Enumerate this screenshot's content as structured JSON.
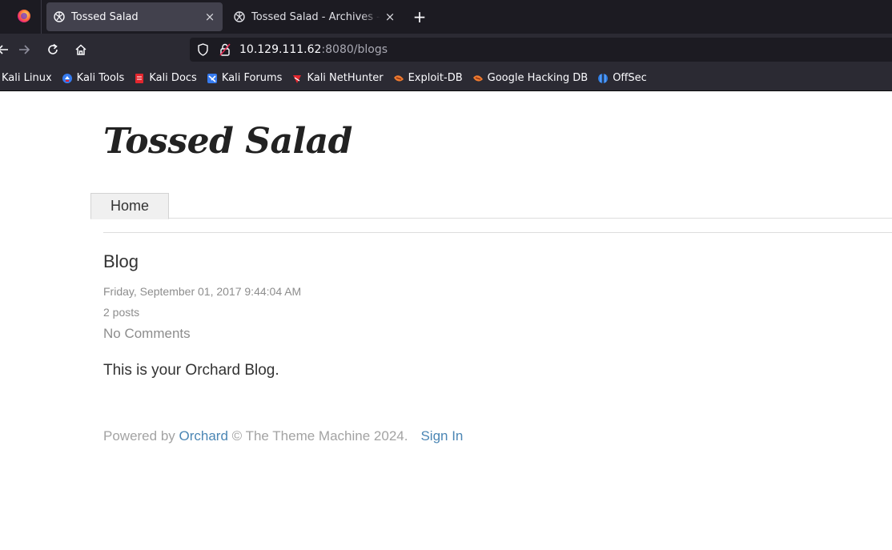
{
  "browser": {
    "tabs": [
      {
        "title": "Tossed Salad",
        "active": true
      },
      {
        "title": "Tossed Salad - Archives - ",
        "active": false
      }
    ],
    "close_glyph": "×",
    "new_tab_glyph": "+",
    "url": {
      "host": "10.129.111.62",
      "rest": ":8080/blogs"
    },
    "bookmarks": [
      {
        "label": "Kali Linux",
        "icon": "kali-icon",
        "color": "#367bf0"
      },
      {
        "label": "Kali Tools",
        "icon": "kali-tools-icon",
        "color": "#367bf0"
      },
      {
        "label": "Kali Docs",
        "icon": "kali-docs-icon",
        "color": "#e3262e"
      },
      {
        "label": "Kali Forums",
        "icon": "kali-forums-icon",
        "color": "#367bf0"
      },
      {
        "label": "Kali NetHunter",
        "icon": "kali-nethunter-icon",
        "color": "#e3262e"
      },
      {
        "label": "Exploit-DB",
        "icon": "exploit-db-icon",
        "color": "#ec7a30"
      },
      {
        "label": "Google Hacking DB",
        "icon": "ghdb-icon",
        "color": "#ec7a30"
      },
      {
        "label": "OffSec",
        "icon": "offsec-icon",
        "color": "#2a7ae2"
      }
    ],
    "colors": {
      "tabbar": "#1c1b22",
      "toolbar": "#2b2a33",
      "active_tab": "#42414d"
    }
  },
  "site": {
    "title": "Tossed Salad",
    "menu": {
      "home_label": "Home"
    },
    "blog": {
      "heading": "Blog",
      "date": "Friday, September 01, 2017 9:44:04 AM",
      "posts": "2 posts",
      "comments": "No Comments",
      "description": "This is your Orchard Blog."
    },
    "footer": {
      "powered_by": "Powered by ",
      "orchard_link": "Orchard",
      "copyright": " © The Theme Machine 2024.",
      "sign_in": "Sign In"
    },
    "colors": {
      "link": "#4b86b4",
      "muted": "#8d8d8d",
      "text": "#333333"
    }
  }
}
